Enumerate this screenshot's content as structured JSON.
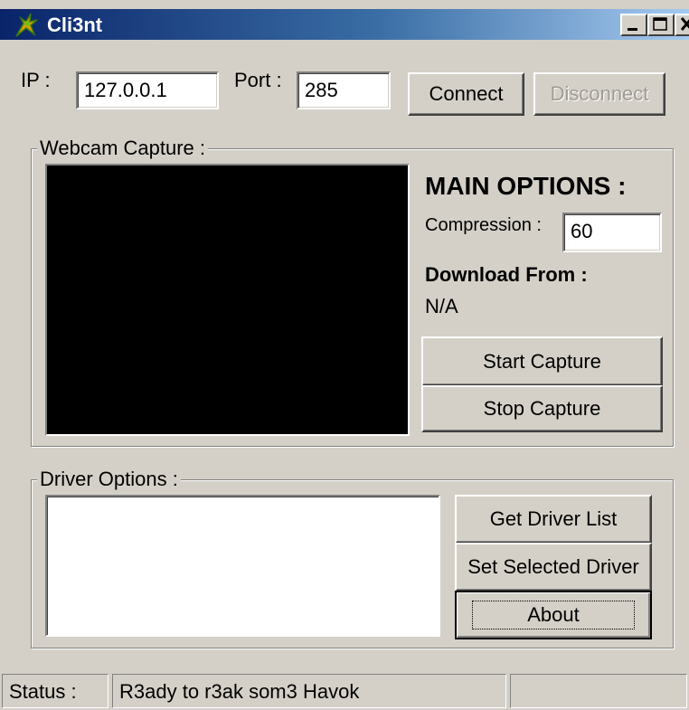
{
  "window": {
    "title": "Cli3nt",
    "icon": "app-icon"
  },
  "connection": {
    "ip_label": "IP :",
    "ip_value": "127.0.0.1",
    "port_label": "Port :",
    "port_value": "285",
    "connect_label": "Connect",
    "disconnect_label": "Disconnect",
    "disconnect_enabled": false
  },
  "webcam": {
    "group_label": "Webcam Capture :",
    "main_options_label": "MAIN OPTIONS :",
    "compression_label": "Compression :",
    "compression_value": "60",
    "download_from_label": "Download From :",
    "download_from_value": "N/A",
    "start_capture_label": "Start Capture",
    "stop_capture_label": "Stop Capture",
    "preview_color": "#000000"
  },
  "driver": {
    "group_label": "Driver Options :",
    "get_list_label": "Get Driver List",
    "set_selected_label": "Set Selected Driver",
    "about_label": "About"
  },
  "statusbar": {
    "label": "Status :",
    "message": "R3ady to r3ak som3 Havok",
    "extra": ""
  },
  "colors": {
    "face": "#d4d0c8",
    "title_start": "#0a246a",
    "title_end": "#a6caf0"
  }
}
